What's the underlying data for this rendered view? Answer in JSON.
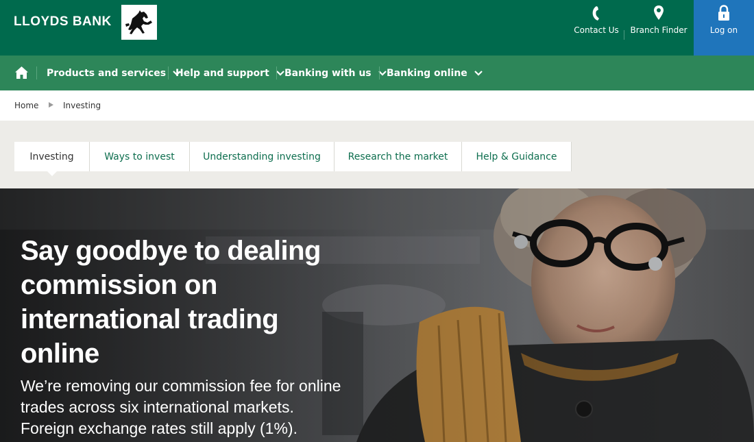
{
  "header": {
    "brand": "LLOYDS BANK",
    "logo": "black-horse-logo",
    "utilities": [
      {
        "label": "Contact Us",
        "icon": "phone-icon"
      },
      {
        "label": "Branch Finder",
        "icon": "map-pin-icon"
      },
      {
        "label": "Log on",
        "icon": "padlock-icon"
      }
    ],
    "colors": {
      "primary": "#006a4d",
      "nav": "#2d8659",
      "logon": "#1f75bb"
    }
  },
  "nav": {
    "home_icon": "home-icon",
    "items": [
      {
        "label": "Products and services"
      },
      {
        "label": "Help and support"
      },
      {
        "label": "Banking with us"
      },
      {
        "label": "Banking online"
      }
    ]
  },
  "breadcrumb": {
    "home": "Home",
    "current": "Investing"
  },
  "tabs": [
    {
      "label": "Investing",
      "active": true
    },
    {
      "label": "Ways to invest"
    },
    {
      "label": "Understanding investing"
    },
    {
      "label": "Research the market"
    },
    {
      "label": "Help & Guidance"
    }
  ],
  "hero": {
    "title": "Say goodbye to dealing commission on international trading online",
    "subtitle": "We’re removing our commission fee for online trades across six international markets. Foreign exchange rates still apply (1%)."
  }
}
